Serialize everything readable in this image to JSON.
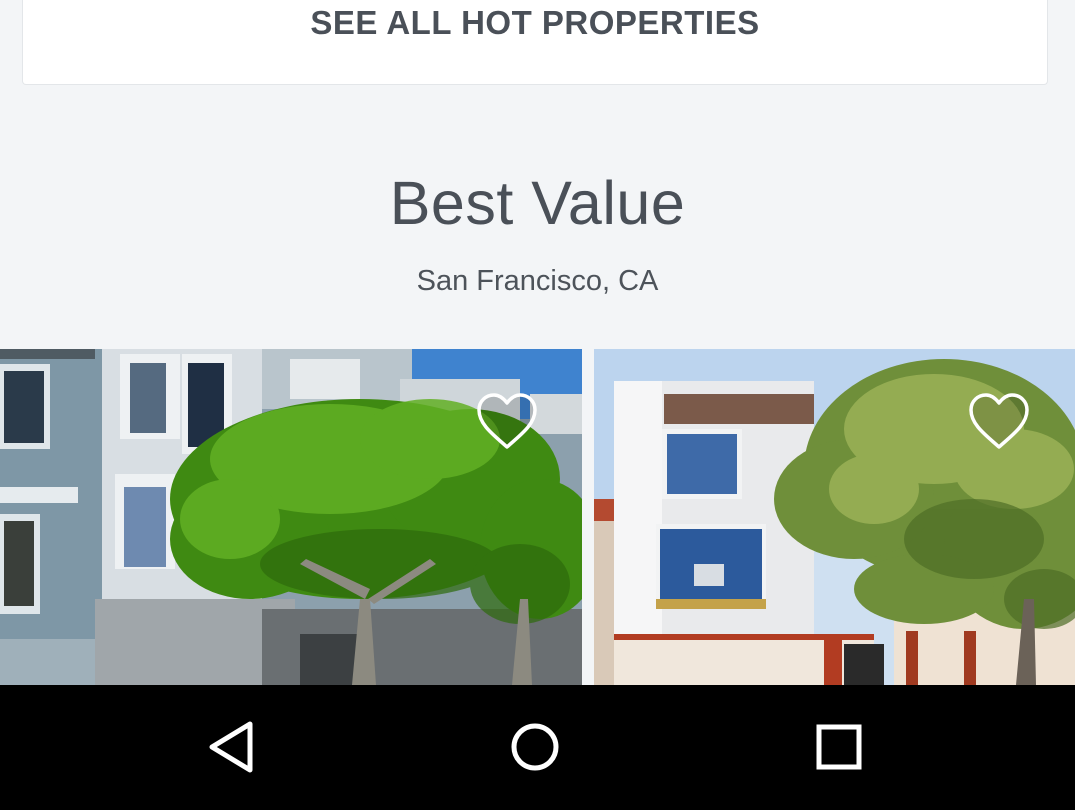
{
  "hot_properties": {
    "link_label": "SEE ALL HOT PROPERTIES"
  },
  "section": {
    "title": "Best Value",
    "location": "San Francisco, CA"
  },
  "listings": [
    {
      "favorite_icon": "heart-outline-icon"
    },
    {
      "favorite_icon": "heart-outline-icon"
    }
  ],
  "system_nav": {
    "back": "back-triangle-icon",
    "home": "home-circle-icon",
    "recents": "recents-square-icon"
  },
  "colors": {
    "page_bg": "#f3f5f7",
    "card_bg": "#ffffff",
    "text": "#4a5058",
    "nav_bg": "#000000"
  }
}
